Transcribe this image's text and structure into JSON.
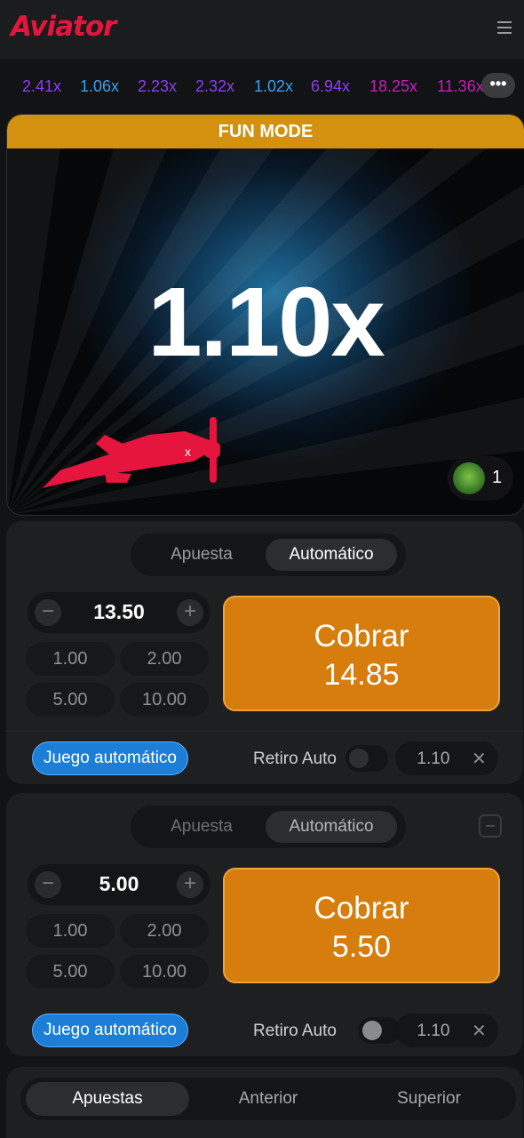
{
  "header": {
    "logo": "Aviator",
    "menu_icon": "hamburger-menu-icon"
  },
  "multipliers": [
    {
      "value": "2.41x",
      "color": "#8d3ef4"
    },
    {
      "value": "1.06x",
      "color": "#3aa0f0"
    },
    {
      "value": "2.23x",
      "color": "#8d3ef4"
    },
    {
      "value": "2.32x",
      "color": "#8d3ef4"
    },
    {
      "value": "1.02x",
      "color": "#3aa0f0"
    },
    {
      "value": "6.94x",
      "color": "#8d3ef4"
    },
    {
      "value": "18.25x",
      "color": "#c71fb8"
    },
    {
      "value": "11.36x",
      "color": "#c71fb8"
    }
  ],
  "more_button": "•••",
  "game": {
    "banner": "FUN MODE",
    "multiplier": "1.10x",
    "players_count": "1",
    "accent": "#e5153d"
  },
  "bet_panels": [
    {
      "tabs": [
        "Apuesta",
        "Automático"
      ],
      "active_tab": "Automático",
      "amount": "13.50",
      "quick_amounts": [
        "1.00",
        "2.00",
        "5.00",
        "10.00"
      ],
      "cashout_label": "Cobrar",
      "cashout_amount": "14.85",
      "auto_play": "Juego automático",
      "retiro_label": "Retiro Auto",
      "retiro_value": "1.10",
      "retiro_enabled": false
    },
    {
      "tabs": [
        "Apuesta",
        "Automático"
      ],
      "active_tab": "Automático",
      "amount": "5.00",
      "quick_amounts": [
        "1.00",
        "2.00",
        "5.00",
        "10.00"
      ],
      "cashout_label": "Cobrar",
      "cashout_amount": "5.50",
      "auto_play": "Juego automático",
      "retiro_label": "Retiro Auto",
      "retiro_value": "1.10",
      "retiro_enabled": false
    }
  ],
  "bottom_tabs": [
    "Apuestas",
    "Anterior",
    "Superior"
  ],
  "bottom_active": "Apuestas"
}
